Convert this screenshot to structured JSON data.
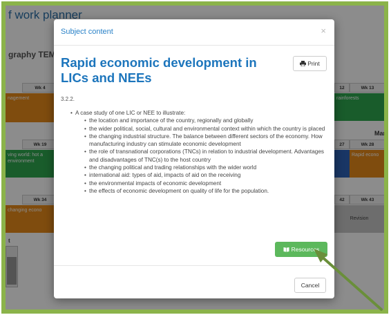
{
  "background": {
    "title": "f work planner",
    "subtitle": "graphy TEM",
    "weeks": [
      "Wk 4",
      "12",
      "Wk 13",
      "Wk 19",
      "27",
      "Wk 28",
      "Wk 34",
      "42",
      "Wk 43"
    ],
    "month_label": "Mar",
    "cells": [
      "nagement",
      "rainforests",
      "ving world: hot a environment",
      "Rapid econo",
      "changing econo",
      "Revision"
    ],
    "mini_heading": "t"
  },
  "modal": {
    "header_title": "Subject content",
    "close_symbol": "×",
    "heading": "Rapid economic development in LICs and NEEs",
    "print_label": "Print",
    "code": "3.2.2.",
    "intro": "A case study of one LIC or NEE to illustrate:",
    "items": [
      "the location and importance of the country, regionally and globally",
      "the wider political, social, cultural and environmental context within which the country is placed",
      "the changing industrial structure. The balance between different sectors of the economy. How manufacturing industry can stimulate economic development",
      "the role of transnational corporations (TNCs) in relation to industrial development. Advantages and disadvantages of TNC(s) to the host country",
      "the changing political and trading relationships with the wider world",
      "international aid: types of aid, impacts of aid on the receiving",
      "the environmental impacts of economic development",
      "the effects of economic development on quality of life for the population."
    ],
    "resources_label": "Resources",
    "cancel_label": "Cancel"
  },
  "colors": {
    "frame": "#8bb34a",
    "heading": "#1c75bc",
    "resources_button": "#5cb85c",
    "arrow": "#6a8f3a"
  }
}
